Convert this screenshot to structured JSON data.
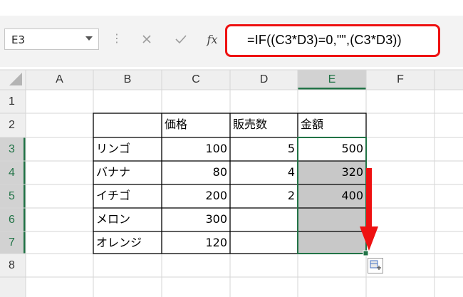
{
  "namebox": {
    "value": "E3"
  },
  "formula_bar": {
    "cancel_icon": "close-icon",
    "confirm_icon": "check-icon",
    "fx_label": "fx",
    "formula": "=IF((C3*D3)=0,\"\",(C3*D3))"
  },
  "columns": [
    "A",
    "B",
    "C",
    "D",
    "E",
    "F"
  ],
  "rows": [
    "1",
    "2",
    "3",
    "4",
    "5",
    "6",
    "7",
    "8"
  ],
  "table": {
    "headers": [
      "価格",
      "販売数",
      "金額"
    ],
    "rows": [
      {
        "name": "リンゴ",
        "price": "100",
        "qty": "5",
        "amount": "500"
      },
      {
        "name": "バナナ",
        "price": "80",
        "qty": "4",
        "amount": "320"
      },
      {
        "name": "イチゴ",
        "price": "200",
        "qty": "2",
        "amount": "400"
      },
      {
        "name": "メロン",
        "price": "300",
        "qty": "",
        "amount": ""
      },
      {
        "name": "オレンジ",
        "price": "120",
        "qty": "",
        "amount": ""
      }
    ]
  },
  "colors": {
    "selection_green": "#217346",
    "fill_gray": "#c8c8c8",
    "annotation_red": "#ee1111"
  },
  "annotation": {
    "arrow_icon": "red-down-arrow-icon"
  },
  "paste_options_icon": "paste-options-icon"
}
